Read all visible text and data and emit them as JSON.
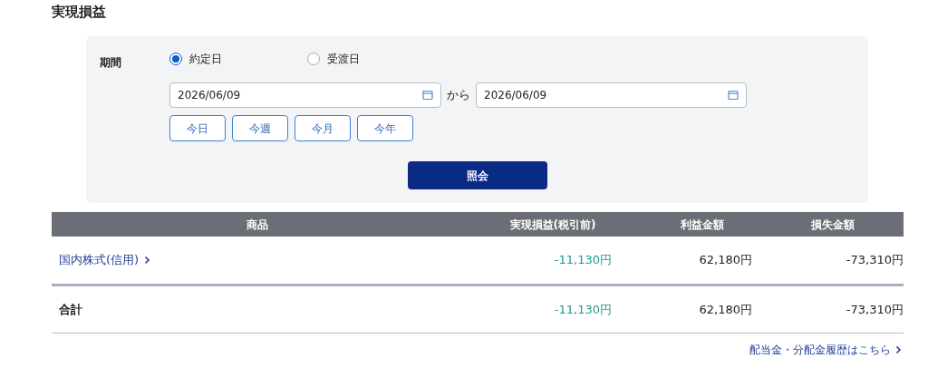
{
  "title": "実現損益",
  "filter": {
    "label": "期間",
    "radios": [
      {
        "label": "約定日",
        "selected": true
      },
      {
        "label": "受渡日",
        "selected": false
      }
    ],
    "from_date": "2026/06/09",
    "separator": "から",
    "to_date": "2026/06/09",
    "quick_buttons": [
      "今日",
      "今週",
      "今月",
      "今年"
    ],
    "submit": "照会"
  },
  "table": {
    "columns": [
      "商品",
      "実現損益(税引前)",
      "利益金額",
      "損失金額"
    ],
    "rows": [
      {
        "kind": "item",
        "cells": [
          {
            "text": "国内株式(信用)",
            "kind": "link"
          },
          {
            "text": "-11,130円",
            "color": "#1f9a8c"
          },
          {
            "text": "62,180円",
            "color": "#222222"
          },
          {
            "text": "-73,310円",
            "color": "#222222"
          }
        ]
      },
      {
        "kind": "total",
        "cells": [
          {
            "text": "合計",
            "kind": "total"
          },
          {
            "text": "-11,130円",
            "color": "#1f9a8c"
          },
          {
            "text": "62,180円",
            "color": "#222222"
          },
          {
            "text": "-73,310円",
            "color": "#222222"
          }
        ]
      }
    ]
  },
  "footer_link": "配当金・分配金履歴はこちら"
}
